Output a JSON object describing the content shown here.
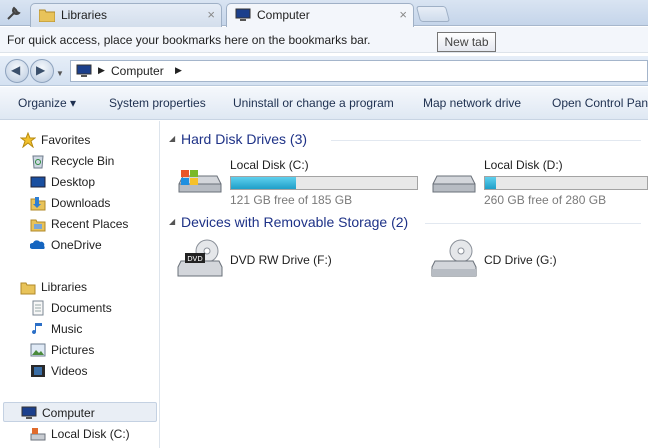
{
  "tabs": [
    {
      "label": "Libraries",
      "icon": "folder-icon",
      "close": "×"
    },
    {
      "label": "Computer",
      "icon": "computer-icon",
      "close": "×"
    }
  ],
  "bookmarks_bar": {
    "message": "For quick access, place your bookmarks here on the bookmarks bar."
  },
  "tooltip": {
    "text": "New tab"
  },
  "address": {
    "crumb": "Computer"
  },
  "commands": [
    {
      "label": "Organize ▾"
    },
    {
      "label": "System properties"
    },
    {
      "label": "Uninstall or change a program"
    },
    {
      "label": "Map network drive"
    },
    {
      "label": "Open Control Panel"
    }
  ],
  "nav": {
    "favorites_header": "Favorites",
    "favorites": [
      {
        "label": "Recycle Bin",
        "icon": "recycle-bin-icon"
      },
      {
        "label": "Desktop",
        "icon": "desktop-icon"
      },
      {
        "label": "Downloads",
        "icon": "downloads-icon"
      },
      {
        "label": "Recent Places",
        "icon": "recent-places-icon"
      },
      {
        "label": "OneDrive",
        "icon": "onedrive-icon"
      }
    ],
    "libraries_header": "Libraries",
    "libraries": [
      {
        "label": "Documents",
        "icon": "documents-icon"
      },
      {
        "label": "Music",
        "icon": "music-icon"
      },
      {
        "label": "Pictures",
        "icon": "pictures-icon"
      },
      {
        "label": "Videos",
        "icon": "videos-icon"
      }
    ],
    "computer_header": "Computer",
    "computer_items": [
      {
        "label": "Local Disk (C:)",
        "icon": "local-disk-icon"
      }
    ]
  },
  "content": {
    "hdd_group": "Hard Disk Drives (3)",
    "removable_group": "Devices with Removable Storage (2)",
    "drives": [
      {
        "name": "Local Disk (C:)",
        "free_text": "121 GB free of 185 GB",
        "used_fraction": 0.35,
        "icon": "windows-drive-icon"
      },
      {
        "name": "Local Disk (D:)",
        "free_text": "260 GB free of 280 GB",
        "used_fraction": 0.07,
        "icon": "hard-drive-icon"
      }
    ],
    "removable": [
      {
        "name": "DVD RW Drive (F:)",
        "icon": "dvd-drive-icon",
        "badge": "DVD"
      },
      {
        "name": "CD Drive (G:)",
        "icon": "cd-drive-icon"
      }
    ]
  },
  "colors": {
    "accent": "#1e3287",
    "bar_fill": "#26a6d1",
    "selection": "#e9eef5"
  }
}
